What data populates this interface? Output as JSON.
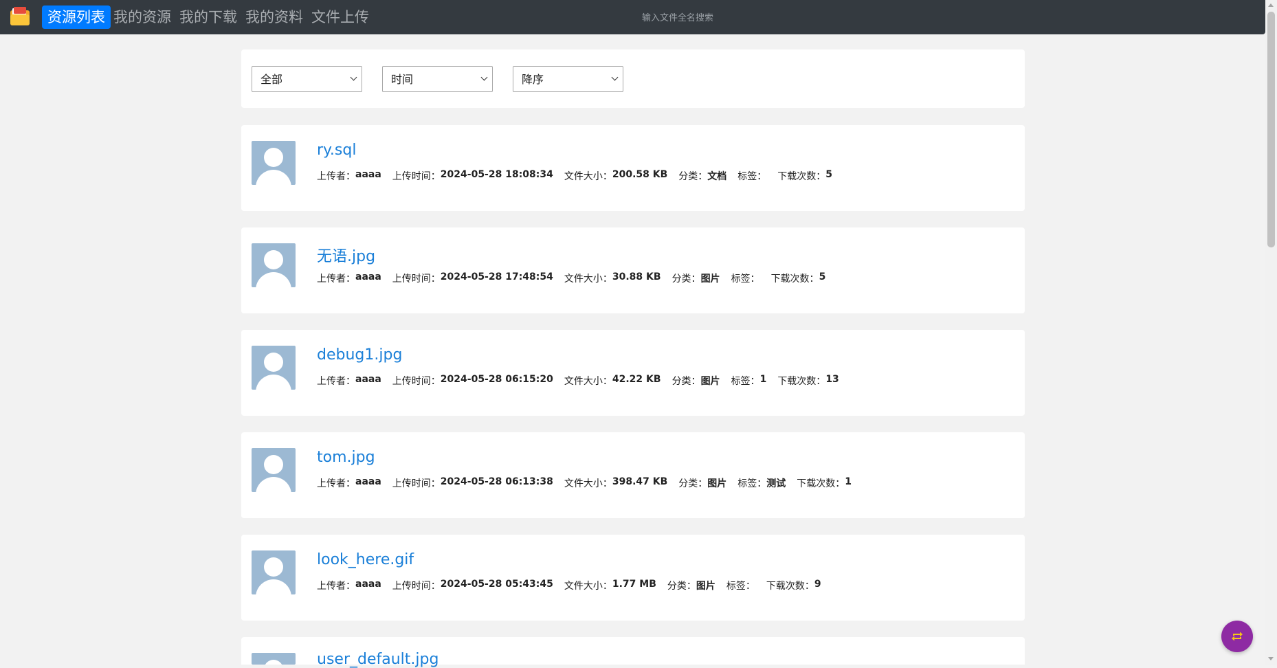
{
  "nav": {
    "items": [
      "资源列表",
      "我的资源",
      "我的下载",
      "我的资料",
      "文件上传"
    ],
    "search_placeholder": "输入文件全名搜索"
  },
  "filters": {
    "category": {
      "selected": "全部",
      "options": [
        "全部"
      ]
    },
    "sort_by": {
      "selected": "时间",
      "options": [
        "时间"
      ]
    },
    "order": {
      "selected": "降序",
      "options": [
        "降序"
      ]
    }
  },
  "labels": {
    "uploader": "上传者：",
    "upload_time": "上传时间：",
    "file_size": "文件大小：",
    "category": "分类：",
    "tags": "标签：",
    "download_count": "下载次数："
  },
  "resources": [
    {
      "name": "ry.sql",
      "uploader": "aaaa",
      "upload_time": "2024-05-28 18:08:34",
      "file_size": "200.58 KB",
      "category": "文档",
      "tags": "",
      "download_count": "5"
    },
    {
      "name": "无语.jpg",
      "uploader": "aaaa",
      "upload_time": "2024-05-28 17:48:54",
      "file_size": "30.88 KB",
      "category": "图片",
      "tags": "",
      "download_count": "5"
    },
    {
      "name": "debug1.jpg",
      "uploader": "aaaa",
      "upload_time": "2024-05-28 06:15:20",
      "file_size": "42.22 KB",
      "category": "图片",
      "tags": "1",
      "download_count": "13"
    },
    {
      "name": "tom.jpg",
      "uploader": "aaaa",
      "upload_time": "2024-05-28 06:13:38",
      "file_size": "398.47 KB",
      "category": "图片",
      "tags": "测试",
      "download_count": "1"
    },
    {
      "name": "look_here.gif",
      "uploader": "aaaa",
      "upload_time": "2024-05-28 05:43:45",
      "file_size": "1.77 MB",
      "category": "图片",
      "tags": "",
      "download_count": "9"
    },
    {
      "name": "user_default.jpg"
    }
  ],
  "colors": {
    "navbar": "#343a40",
    "active_nav": "#007bff",
    "link": "#1a7fd8",
    "fab": "#8e2aa3"
  }
}
